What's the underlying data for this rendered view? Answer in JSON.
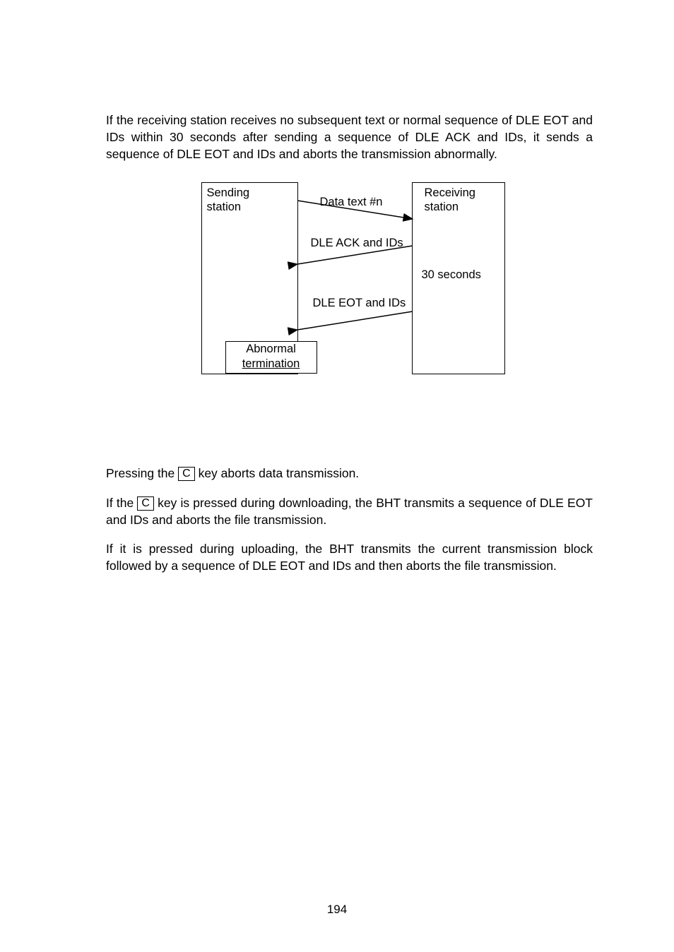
{
  "para1": "If the receiving station receives no subsequent text or normal sequence of DLE EOT and IDs within 30 seconds after sending a sequence of DLE ACK and IDs, it sends a sequence of DLE EOT and IDs and aborts the transmission abnormally.",
  "diagram": {
    "sender": "Sending\nstation",
    "receiver": "Receiving\nstation",
    "msg1": "Data text #n",
    "msg2": "DLE ACK and IDs",
    "msg3": "DLE EOT and IDs",
    "timeout": "30 seconds",
    "abnormal_l1": "Abnormal",
    "abnormal_l2": "termination"
  },
  "para2_pre": "Pressing the ",
  "para2_key": "C",
  "para2_post": " key aborts data transmission.",
  "para3_pre": "If the ",
  "para3_key": "C",
  "para3_post": " key is pressed during downloading, the BHT transmits a sequence of DLE EOT and IDs and aborts the file transmission.",
  "para4": "If it is pressed during uploading, the BHT transmits the current transmission block followed by a sequence of DLE EOT and IDs and then aborts the file transmission.",
  "page_number": "194"
}
